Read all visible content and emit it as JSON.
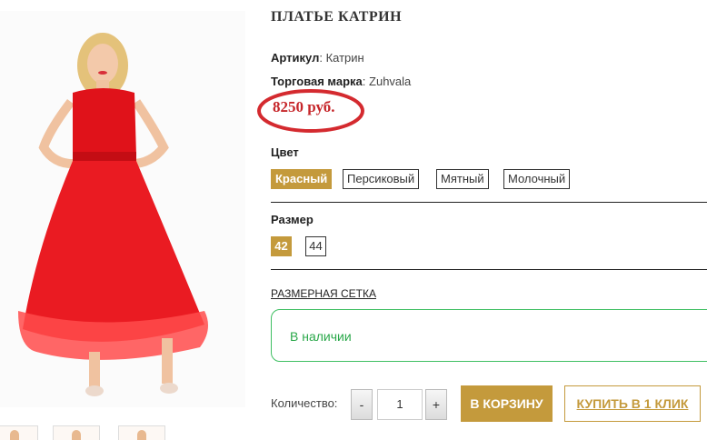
{
  "product": {
    "title": "ПЛАТЬЕ КАТРИН",
    "sku_label": "Артикул",
    "sku_value": ": Катрин",
    "brand_label": "Торговая марка",
    "brand_value": ": Zuhvala",
    "price": "8250 руб."
  },
  "color": {
    "label": "Цвет",
    "options": [
      "Красный",
      "Персиковый",
      "Мятный",
      "Молочный"
    ],
    "selected": "Красный"
  },
  "size": {
    "label": "Размер",
    "options": [
      "42",
      "44"
    ],
    "selected": "42"
  },
  "size_chart_link": "РАЗМЕРНАЯ СЕТКА",
  "availability": "В наличии",
  "purchase": {
    "qty_label": "Количество:",
    "qty_value": "1",
    "minus": "-",
    "plus": "+",
    "cart_button": "В КОРЗИНУ",
    "one_click_button": "КУПИТЬ В 1 КЛИК"
  },
  "colors": {
    "accent": "#c49a3c",
    "price": "#c6262a",
    "stock": "#2aa84a"
  }
}
